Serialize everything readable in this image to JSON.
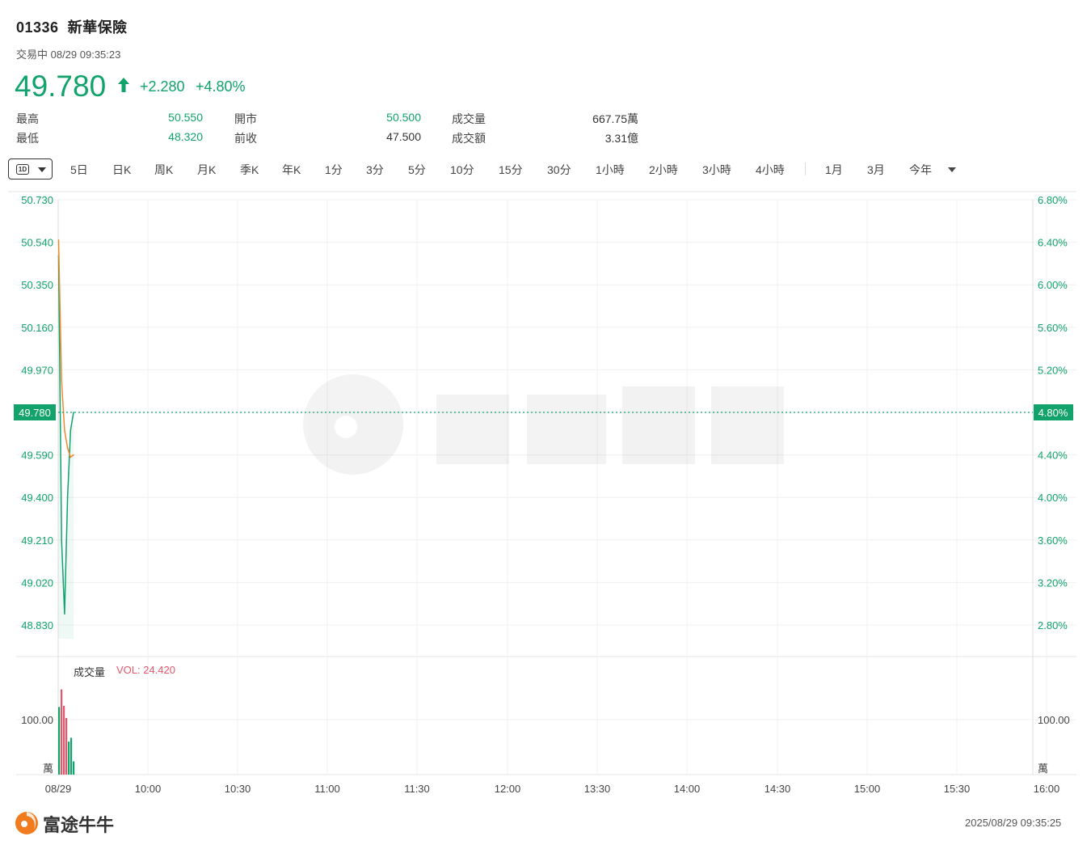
{
  "header": {
    "code": "01336",
    "name": "新華保險",
    "status": "交易中 08/29 09:35:23",
    "price": "49.780",
    "change": "+2.280",
    "change_pct": "+4.80%",
    "price_color": "#11a36b"
  },
  "stats": {
    "high_label": "最高",
    "high_value": "50.550",
    "low_label": "最低",
    "low_value": "48.320",
    "open_label": "開市",
    "open_value": "50.500",
    "prev_close_label": "前收",
    "prev_close_value": "47.500",
    "volume_label": "成交量",
    "volume_value": "667.75萬",
    "turnover_label": "成交額",
    "turnover_value": "3.31億"
  },
  "tabs": {
    "active": "1D",
    "items": [
      "5日",
      "日K",
      "周K",
      "月K",
      "季K",
      "年K",
      "1分",
      "3分",
      "5分",
      "10分",
      "15分",
      "30分",
      "1小時",
      "2小時",
      "3小時",
      "4小時",
      "1月",
      "3月",
      "今年"
    ]
  },
  "volume_panel": {
    "title": "成交量",
    "vol_label": "VOL: 24.420"
  },
  "footer": {
    "brand": "富途牛牛",
    "timestamp": "2025/08/29 09:35:25"
  },
  "chart_data": {
    "type": "line",
    "x_ticks": [
      "08/29",
      "10:00",
      "10:30",
      "11:00",
      "11:30",
      "12:00",
      "13:30",
      "14:00",
      "14:30",
      "15:00",
      "15:30",
      "16:00"
    ],
    "y_ticks_price": [
      "50.730",
      "50.540",
      "50.350",
      "50.160",
      "49.970",
      "49.780",
      "49.590",
      "49.400",
      "49.210",
      "49.020",
      "48.830"
    ],
    "y_ticks_pct": [
      "6.80%",
      "6.40%",
      "6.00%",
      "5.60%",
      "5.20%",
      "4.80%",
      "4.40%",
      "4.00%",
      "3.60%",
      "3.20%",
      "2.80%"
    ],
    "ylim": [
      48.75,
      50.77
    ],
    "current_price_label": "49.780",
    "current_pct_label": "4.80%",
    "reference_price": 49.78,
    "series": [
      {
        "role": "price",
        "color": "#11a36b",
        "x": [
          "09:30",
          "09:31",
          "09:32",
          "09:33",
          "09:34",
          "09:35"
        ],
        "values": [
          50.48,
          49.21,
          48.88,
          49.4,
          49.7,
          49.78
        ]
      },
      {
        "role": "average",
        "color": "#f08a2c",
        "x": [
          "09:30",
          "09:31",
          "09:32",
          "09:33",
          "09:34",
          "09:35"
        ],
        "values": [
          50.55,
          49.92,
          49.7,
          49.62,
          49.58,
          49.59
        ]
      }
    ],
    "volume": {
      "ticks": [
        "100.00",
        "萬"
      ],
      "unit_top": 100,
      "bars": [
        {
          "x": "09:30",
          "value": 123,
          "color": "#11a36b"
        },
        {
          "x": "09:30",
          "value": 155,
          "color": "#e5566b"
        },
        {
          "x": "09:31",
          "value": 125,
          "color": "#e5566b"
        },
        {
          "x": "09:31",
          "value": 103,
          "color": "#e5566b"
        },
        {
          "x": "09:32",
          "value": 60,
          "color": "#11a36b"
        },
        {
          "x": "09:33",
          "value": 67,
          "color": "#11a36b"
        },
        {
          "x": "09:34",
          "value": 24,
          "color": "#11a36b"
        }
      ]
    }
  }
}
